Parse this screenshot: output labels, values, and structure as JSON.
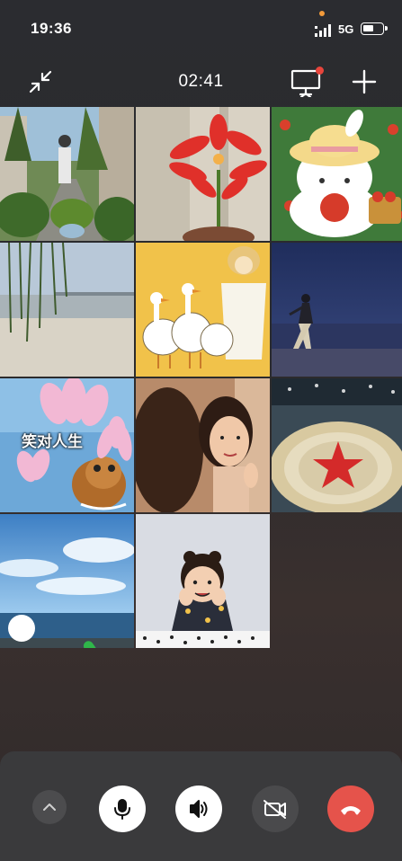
{
  "status_bar": {
    "time": "19:36",
    "network": "5G",
    "battery_level": 0.5,
    "icons": [
      "signal-icon",
      "battery-icon"
    ]
  },
  "call": {
    "duration": "02:41",
    "icons": [
      "minimize-icon",
      "screen-share-icon",
      "add-participant-icon"
    ]
  },
  "participants": [
    {
      "name": "participant-1",
      "video": "woman-on-palm-path"
    },
    {
      "name": "participant-2",
      "video": "red-flower"
    },
    {
      "name": "participant-3",
      "video": "cartoon-bunny-apple"
    },
    {
      "name": "participant-4",
      "video": "willow-river"
    },
    {
      "name": "participant-5",
      "video": "geese-girl-illustration"
    },
    {
      "name": "participant-6",
      "video": "night-beach-dancer"
    },
    {
      "name": "participant-7",
      "video": "lotus-bunny-cartoon",
      "caption": "笑对人生"
    },
    {
      "name": "participant-8",
      "video": "woman-portrait"
    },
    {
      "name": "participant-9",
      "video": "star-emblem"
    },
    {
      "name": "participant-10",
      "video": "sky-sea",
      "speaking": true
    },
    {
      "name": "participant-11",
      "video": "little-girl-polka-dot"
    }
  ],
  "controls": [
    {
      "name": "expand-button",
      "icon": "chevron-up-icon"
    },
    {
      "name": "microphone-button",
      "icon": "microphone-icon"
    },
    {
      "name": "speaker-button",
      "icon": "speaker-icon"
    },
    {
      "name": "camera-off-button",
      "icon": "camera-off-icon"
    },
    {
      "name": "hang-up-button",
      "icon": "hang-up-icon",
      "color": "#e5534b"
    }
  ]
}
